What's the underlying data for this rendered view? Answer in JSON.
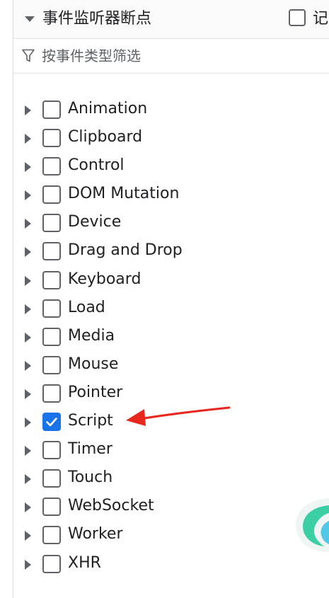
{
  "header": {
    "title": "事件监听器断点",
    "cut_label": "记"
  },
  "filter": {
    "placeholder": "按事件类型筛选",
    "value": ""
  },
  "categories": [
    {
      "label": "Animation",
      "checked": false
    },
    {
      "label": "Clipboard",
      "checked": false
    },
    {
      "label": "Control",
      "checked": false
    },
    {
      "label": "DOM Mutation",
      "checked": false
    },
    {
      "label": "Device",
      "checked": false
    },
    {
      "label": "Drag and Drop",
      "checked": false
    },
    {
      "label": "Keyboard",
      "checked": false
    },
    {
      "label": "Load",
      "checked": false
    },
    {
      "label": "Media",
      "checked": false
    },
    {
      "label": "Mouse",
      "checked": false
    },
    {
      "label": "Pointer",
      "checked": false
    },
    {
      "label": "Script",
      "checked": true
    },
    {
      "label": "Timer",
      "checked": false
    },
    {
      "label": "Touch",
      "checked": false
    },
    {
      "label": "WebSocket",
      "checked": false
    },
    {
      "label": "Worker",
      "checked": false
    },
    {
      "label": "XHR",
      "checked": false
    }
  ],
  "colors": {
    "accent": "#1a73e8",
    "annotation": "#e8271f"
  },
  "icons": {
    "collapse": "triangle-down-icon",
    "expand": "triangle-right-icon",
    "filter": "filter-icon",
    "check": "checkmark-icon"
  }
}
